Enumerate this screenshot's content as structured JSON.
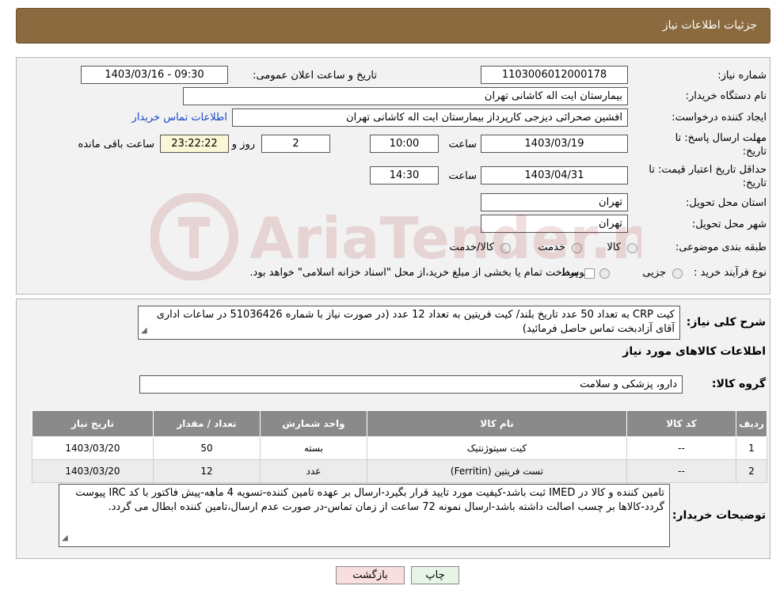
{
  "header": {
    "title": "جزئیات اطلاعات نیاز"
  },
  "form": {
    "need_number_label": "شماره نیاز:",
    "need_number": "1103006012000178",
    "announce_label": "تاریخ و ساعت اعلان عمومی:",
    "announce_value": "1403/03/16 - 09:30",
    "buyer_org_label": "نام دستگاه خریدار:",
    "buyer_org": "بیمارستان ایت اله کاشانی تهران",
    "creator_label": "ایجاد کننده درخواست:",
    "creator": "افشین صحرائی دیزجی کارپرداز بیمارستان ایت اله کاشانی تهران",
    "contact_link": "اطلاعات تماس خریدار",
    "deadline_label_1": "مهلت ارسال پاسخ: تا",
    "deadline_label_2": "تاریخ:",
    "deadline_date": "1403/03/19",
    "time_label": "ساعت",
    "deadline_time": "10:00",
    "days_value": "2",
    "days_label": "روز و",
    "remaining_value": "23:22:22",
    "remaining_label": "ساعت باقی مانده",
    "validity_label_1": "حداقل تاریخ اعتبار قیمت: تا",
    "validity_label_2": "تاریخ:",
    "validity_date": "1403/04/31",
    "validity_time_label": "ساعت",
    "validity_time": "14:30",
    "province_label": "استان محل تحویل:",
    "province": "تهران",
    "city_label": "شهر محل تحویل:",
    "city": "تهران",
    "category_label": "طبقه بندی موضوعی:",
    "category_options": [
      "کالا",
      "خدمت",
      "کالا/خدمت"
    ],
    "process_label": "نوع فرآیند خرید :",
    "process_options": [
      "جزیی",
      "متوسط"
    ],
    "process_note": "پرداخت تمام یا بخشی از مبلغ خرید،از محل \"اسناد خزانه اسلامی\" خواهد بود."
  },
  "details": {
    "summary_label": "شرح کلی نیاز:",
    "summary_text": "کیت CRP به تعداد 50 عدد تاریخ بلند/ کیت فریتین به تعداد 12 عدد (در صورت نیاز با شماره 51036426 در ساعات اداری آقای آزادبخت تماس حاصل فرمائید)",
    "goods_info_title": "اطلاعات کالاهای مورد نیاز",
    "goods_group_label": "گروه کالا:",
    "goods_group": "دارو، پزشکی و سلامت",
    "table": {
      "headers": [
        "ردیف",
        "کد کالا",
        "نام کالا",
        "واحد شمارش",
        "تعداد / مقدار",
        "تاریخ نیاز"
      ],
      "rows": [
        [
          "1",
          "--",
          "کیت سیتوژنتیک",
          "بسته",
          "50",
          "1403/03/20"
        ],
        [
          "2",
          "--",
          "تست فریتین (Ferritin)",
          "عدد",
          "12",
          "1403/03/20"
        ]
      ]
    },
    "buyer_notes_label": "توضیحات خریدار:",
    "buyer_notes": "تامین کننده و کالا در IMED ثبت باشد-کیفیت مورد تایید قرار بگیرد-ارسال بر عهده تامین کننده-تسویه 4 ماهه-پیش فاکتور با کد IRC پیوست گردد-کالاها بر چسب اصالت داشته باشد-ارسال نمونه 72 ساعت از زمان تماس-در صورت عدم ارسال،تامین کننده ابطال می گردد."
  },
  "buttons": {
    "print": "چاپ",
    "back": "بازگشت"
  },
  "watermark": {
    "text": "AriaTender.neT"
  },
  "colors": {
    "header_bg": "#8a6a3e",
    "table_header_bg": "#8a8a8a",
    "link": "#1a47c8",
    "back_button_bg": "#f8dede",
    "print_button_bg": "#e6f5e6"
  }
}
